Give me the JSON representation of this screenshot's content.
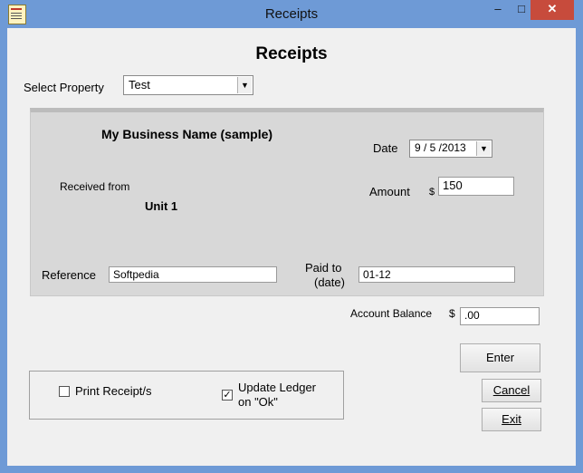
{
  "window": {
    "title": "Receipts",
    "min_label": "–",
    "max_label": "□",
    "close_label": "✕"
  },
  "form": {
    "heading": "Receipts",
    "select_property_label": "Select Property",
    "property_value": "Test",
    "business_name": "My Business Name (sample)",
    "date_label": "Date",
    "date_value": "9 / 5 /2013",
    "received_from_label": "Received from",
    "unit_value": "Unit 1",
    "amount_label": "Amount",
    "currency_symbol": "$",
    "amount_value": "150",
    "reference_label": "Reference",
    "reference_value": "Softpedia",
    "paid_to_label_line1": "Paid to",
    "paid_to_label_line2": "(date)",
    "paid_to_value": "01-12",
    "account_balance_label": "Account Balance",
    "account_balance_currency": "$",
    "account_balance_value": ".00"
  },
  "options": {
    "print_receipts_label": "Print Receipt/s",
    "print_receipts_checked": false,
    "update_ledger_label_line1": "Update Ledger",
    "update_ledger_label_line2": "on \"Ok\"",
    "update_ledger_checked": true
  },
  "buttons": {
    "enter": "Enter",
    "cancel": "Cancel",
    "exit": "Exit"
  },
  "colors": {
    "titlebar": "#6e9ad6",
    "close_button": "#c74b3c",
    "panel": "#d8d8d8"
  }
}
